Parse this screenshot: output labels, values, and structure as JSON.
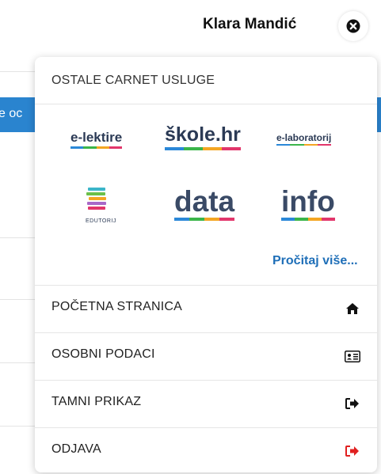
{
  "header": {
    "user_name": "Klara Mandić"
  },
  "background": {
    "button_fragment": "e oc"
  },
  "menu": {
    "title": "OSTALE CARNET USLUGE",
    "services": [
      {
        "name": "e-lektire"
      },
      {
        "name": "škole.hr"
      },
      {
        "name": "e-laboratorij"
      },
      {
        "name": "EDUTORIJ"
      },
      {
        "name": "data"
      },
      {
        "name": "info"
      }
    ],
    "read_more": "Pročitaj više...",
    "items": [
      {
        "label": "POČETNA STRANICA",
        "icon": "home-icon"
      },
      {
        "label": "OSOBNI PODACI",
        "icon": "id-card-icon"
      },
      {
        "label": "TAMNI PRIKAZ",
        "icon": "sign-out-icon"
      },
      {
        "label": "ODJAVA",
        "icon": "sign-out-icon"
      }
    ]
  },
  "colors": {
    "accent_blue": "#1f6fb8",
    "logout_red": "#e02020",
    "logo_navy": "#2b3a55"
  }
}
